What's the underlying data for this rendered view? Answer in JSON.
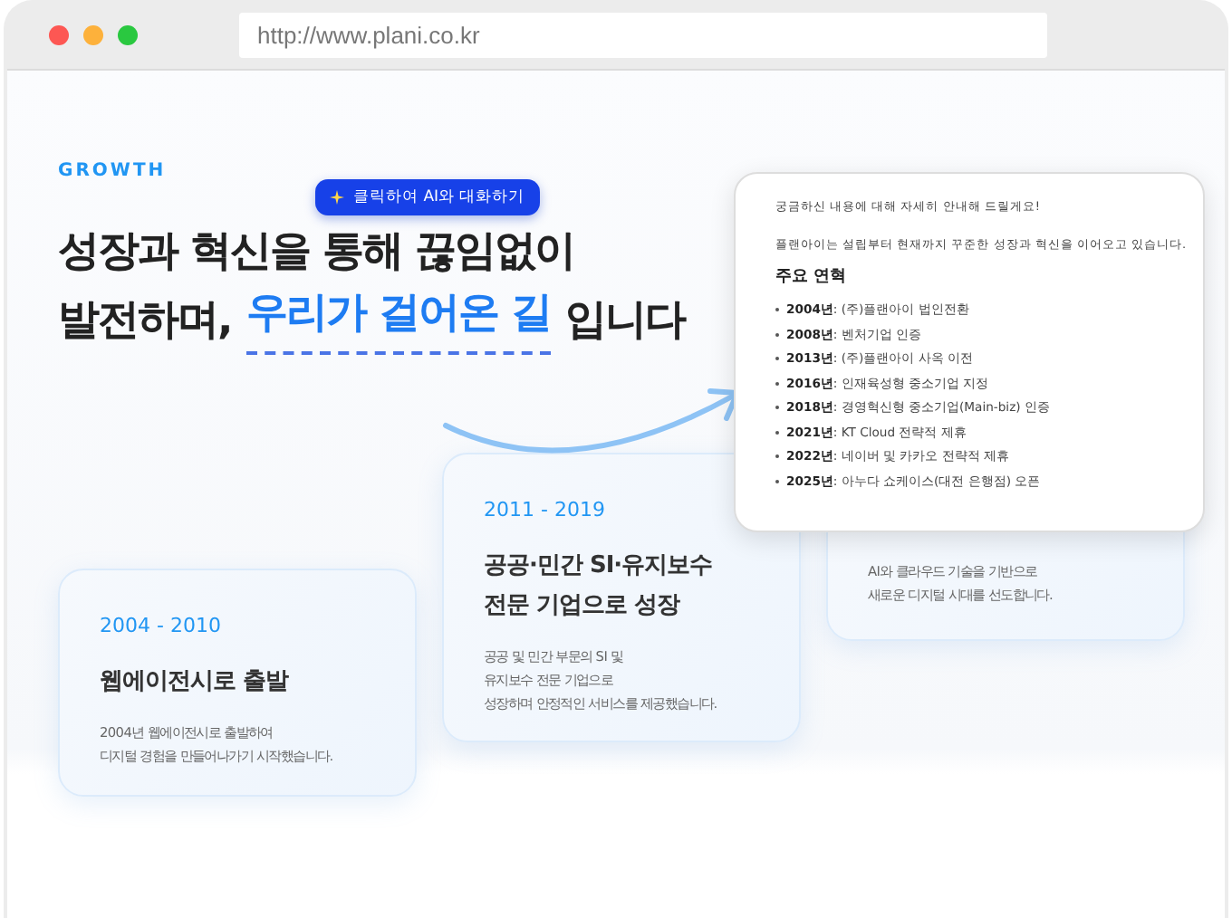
{
  "browser": {
    "url": "http://www.plani.co.kr"
  },
  "section": {
    "eyebrow": "GROWTH",
    "heading_line1": "성장과 혁신을 통해 끊임없이",
    "heading_line2_start": "발전하며,",
    "heading_highlight": "우리가 걸어온 길",
    "heading_line2_end": "입니다"
  },
  "tooltip": {
    "label": "클릭하여 AI와 대화하기"
  },
  "cards": [
    {
      "period": "2004 - 2010",
      "title": "웹에이전시로 출발",
      "description": [
        "2004년 웹에이전시로 출발하여",
        "디지털 경험을 만들어나가기 시작했습니다."
      ]
    },
    {
      "period": "2011 - 2019",
      "title": "공공·민간 SI·유지보수\n전문 기업으로 성장",
      "description": [
        "공공 및 민간 부문의 SI 및",
        "유지보수 전문 기업으로",
        "성장하며 안정적인 서비스를 제공했습니다."
      ]
    },
    {
      "description": [
        "AI와 클라우드 기술을 기반으로",
        "새로운 디지털 시대를 선도합니다."
      ]
    }
  ],
  "chat_popup": {
    "greeting": "궁금하신 내용에 대해 자세히 안내해 드릴게요!",
    "intro": "플랜아이는 설립부터 현재까지 꾸준한 성장과 혁신을 이어오고 있습니다.",
    "heading": "주요 연혁",
    "items": [
      "**2004년**: (주)플랜아이 법인전환",
      "**2008년**: 벤처기업 인증",
      "**2013년**: (주)플랜아이 사옥 이전",
      "**2016년**: 인재육성형 중소기업 지정",
      "**2018년**: 경영혁신형 중소기업(Main-biz) 인증",
      "**2021년**: KT Cloud 전략적 제휴",
      "**2022년**: 네이버 및 카카오 전략적 제휴",
      "**2025년**: 아누다 쇼케이스(대전 은행점) 오픈"
    ]
  }
}
